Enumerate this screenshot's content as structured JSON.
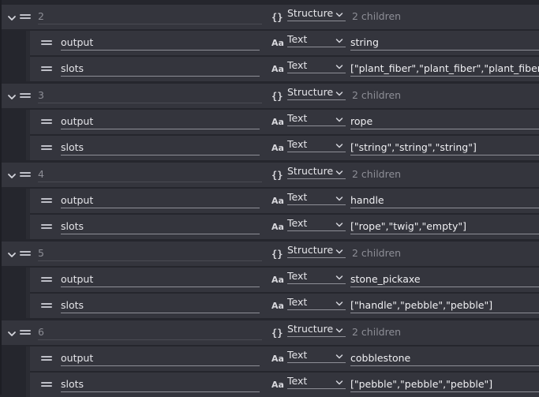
{
  "groups": [
    {
      "index": "2",
      "type_icon": "{}",
      "type": "Structure",
      "summary": "2 children",
      "children": [
        {
          "key": "output",
          "type_icon": "Aa",
          "type": "Text",
          "value": "string"
        },
        {
          "key": "slots",
          "type_icon": "Aa",
          "type": "Text",
          "value": "[\"plant_fiber\",\"plant_fiber\",\"plant_fiber\"]"
        }
      ]
    },
    {
      "index": "3",
      "type_icon": "{}",
      "type": "Structure",
      "summary": "2 children",
      "children": [
        {
          "key": "output",
          "type_icon": "Aa",
          "type": "Text",
          "value": "rope"
        },
        {
          "key": "slots",
          "type_icon": "Aa",
          "type": "Text",
          "value": "[\"string\",\"string\",\"string\"]"
        }
      ]
    },
    {
      "index": "4",
      "type_icon": "{}",
      "type": "Structure",
      "summary": "2 children",
      "children": [
        {
          "key": "output",
          "type_icon": "Aa",
          "type": "Text",
          "value": "handle"
        },
        {
          "key": "slots",
          "type_icon": "Aa",
          "type": "Text",
          "value": "[\"rope\",\"twig\",\"empty\"]"
        }
      ]
    },
    {
      "index": "5",
      "type_icon": "{}",
      "type": "Structure",
      "summary": "2 children",
      "children": [
        {
          "key": "output",
          "type_icon": "Aa",
          "type": "Text",
          "value": "stone_pickaxe"
        },
        {
          "key": "slots",
          "type_icon": "Aa",
          "type": "Text",
          "value": "[\"handle\",\"pebble\",\"pebble\"]"
        }
      ]
    },
    {
      "index": "6",
      "type_icon": "{}",
      "type": "Structure",
      "summary": "2 children",
      "children": [
        {
          "key": "output",
          "type_icon": "Aa",
          "type": "Text",
          "value": "cobblestone"
        },
        {
          "key": "slots",
          "type_icon": "Aa",
          "type": "Text",
          "value": "[\"pebble\",\"pebble\",\"pebble\"]"
        }
      ]
    }
  ],
  "icons": {
    "expand": "chevron-down-icon",
    "drag": "drag-handle-icon",
    "dropdown": "caret-down-icon"
  },
  "colors": {
    "background": "#25262d",
    "row": "#34353d",
    "text": "#e6e6ea",
    "muted": "#8d8e96"
  }
}
